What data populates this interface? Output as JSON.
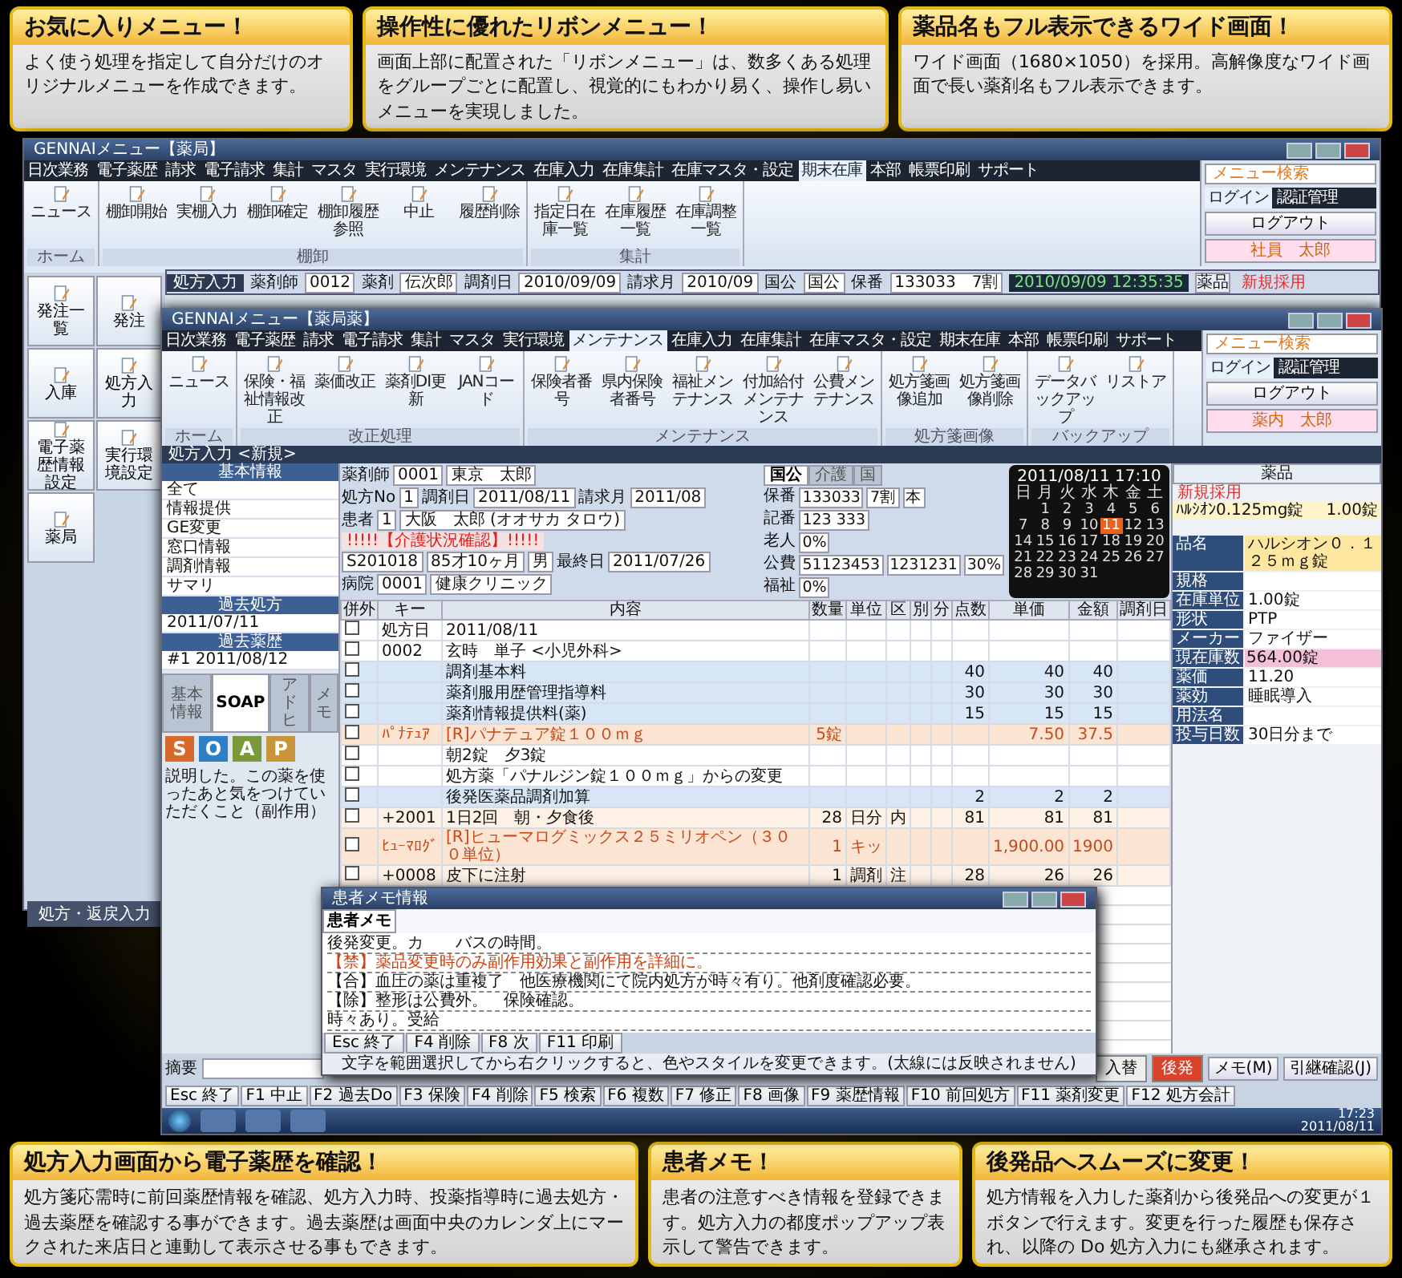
{
  "top_callouts": [
    {
      "title": "お気に入りメニュー！",
      "body": "よく使う処理を指定して自分だけのオリジナルメニューを作成できます。"
    },
    {
      "title": "操作性に優れたリボンメニュー！",
      "body": "画面上部に配置された「リボンメニュー」は、数多くある処理をグループごとに配置し、視覚的にもわかり易く、操作し易いメニューを実現しました。"
    },
    {
      "title": "薬品名もフル表示できるワイド画面！",
      "body": "ワイド画面（1680×1050）を採用。高解像度なワイド画面で長い薬剤名もフル表示できます。"
    }
  ],
  "back_window": {
    "title": "GENNAIメニュー【薬局】",
    "tabs": [
      {
        "label": "日次業務",
        "selected": false
      },
      {
        "label": "電子薬歴",
        "selected": false
      },
      {
        "label": "請求",
        "selected": false
      },
      {
        "label": "電子請求",
        "selected": false
      },
      {
        "label": "集計",
        "selected": false
      },
      {
        "label": "マスタ",
        "selected": false
      },
      {
        "label": "実行環境",
        "selected": false
      },
      {
        "label": "メンテナンス",
        "selected": false
      },
      {
        "label": "在庫入力",
        "selected": false
      },
      {
        "label": "在庫集計",
        "selected": false
      },
      {
        "label": "在庫マスタ・設定",
        "selected": false
      },
      {
        "label": "期末在庫",
        "selected": true
      },
      {
        "label": "本部",
        "selected": false
      },
      {
        "label": "帳票印刷",
        "selected": false
      },
      {
        "label": "サポート",
        "selected": false
      }
    ],
    "ribbon_groups": [
      {
        "label": "ホーム",
        "buttons": [
          "ニュース"
        ]
      },
      {
        "label": "棚卸",
        "buttons": [
          "棚卸開始",
          "実棚入力",
          "棚卸確定",
          "棚卸履歴参照",
          "中止",
          "履歴削除"
        ]
      },
      {
        "label": "集計",
        "buttons": [
          "指定日在庫一覧",
          "在庫履歴一覧",
          "在庫調整一覧"
        ]
      }
    ],
    "menu_search": {
      "placeholder": "メニュー検索"
    },
    "login_tabs": [
      {
        "label": "ログイン",
        "selected": true
      },
      {
        "label": "認証管理",
        "selected": false
      }
    ],
    "logout": "ログアウト",
    "user": "社員　太郎",
    "sidebar": [
      "発注一覧",
      "発注",
      "入庫",
      "処方入力",
      "電子薬歴情報設定",
      "実行環境設定",
      "薬局"
    ],
    "sidebar_footer": "処方・返戻入力",
    "rx": {
      "title": "処方入力",
      "fields": [
        {
          "label": "薬剤師",
          "value": "0012"
        },
        {
          "label": "薬剤",
          "value": "伝次郎"
        },
        {
          "label": "調剤日",
          "value": "2010/09/09"
        },
        {
          "label": "請求月",
          "value": "2010/09"
        }
      ],
      "insurance": [
        {
          "label": "国公",
          "value": "国公"
        },
        {
          "label": "保番",
          "value": "133033　7割"
        }
      ],
      "clock": "2010/09/09 12:35:35",
      "drug_header": "薬品",
      "drug_note": "新規採用"
    }
  },
  "front_window": {
    "title": "GENNAIメニュー【薬局薬】",
    "tabs": [
      {
        "label": "日次業務",
        "selected": false
      },
      {
        "label": "電子薬歴",
        "selected": false
      },
      {
        "label": "請求",
        "selected": false
      },
      {
        "label": "電子請求",
        "selected": false
      },
      {
        "label": "集計",
        "selected": false
      },
      {
        "label": "マスタ",
        "selected": false
      },
      {
        "label": "実行環境",
        "selected": false
      },
      {
        "label": "メンテナンス",
        "selected": true
      },
      {
        "label": "在庫入力",
        "selected": false
      },
      {
        "label": "在庫集計",
        "selected": false
      },
      {
        "label": "在庫マスタ・設定",
        "selected": false
      },
      {
        "label": "期末在庫",
        "selected": false
      },
      {
        "label": "本部",
        "selected": false
      },
      {
        "label": "帳票印刷",
        "selected": false
      },
      {
        "label": "サポート",
        "selected": false
      }
    ],
    "ribbon_groups": [
      {
        "label": "ホーム",
        "buttons": [
          "ニュース"
        ]
      },
      {
        "label": "改正処理",
        "buttons": [
          "保険・福祉情報改正",
          "薬価改正",
          "薬剤DI更新",
          "JANコード"
        ]
      },
      {
        "label": "メンテナンス",
        "buttons": [
          "保険者番号",
          "県内保険者番号",
          "福祉メンテナンス",
          "付加給付メンテナンス",
          "公費メンテナンス"
        ]
      },
      {
        "label": "処方箋画像",
        "buttons": [
          "処方箋画像追加",
          "処方箋画像削除"
        ]
      },
      {
        "label": "バックアップ",
        "buttons": [
          "データバックアップ",
          "リストア"
        ]
      }
    ],
    "menu_search": {
      "placeholder": "メニュー検索"
    },
    "login_tabs": [
      {
        "label": "ログイン",
        "selected": true
      },
      {
        "label": "認証管理",
        "selected": false
      }
    ],
    "logout": "ログアウト",
    "user": "薬内　太郎",
    "rx": {
      "title": "処方入力 <新規>",
      "left_sections": [
        {
          "header": "基本情報",
          "items": [
            "全て",
            "情報提供",
            "GE変更",
            "窓口情報",
            "調剤情報",
            "サマリ"
          ]
        },
        {
          "header": "過去処方",
          "items": [
            "2011/07/11"
          ]
        },
        {
          "header": "過去薬歴",
          "items": [
            "#1 2011/08/12"
          ]
        }
      ],
      "left_tabs": [
        {
          "label": "基本情報",
          "selected": false
        },
        {
          "label": "SOAP",
          "selected": true
        },
        {
          "label": "アドヒ",
          "selected": false
        },
        {
          "label": "メモ",
          "selected": false
        }
      ],
      "soap": [
        {
          "letter": "S",
          "color": "#d9692a"
        },
        {
          "letter": "O",
          "color": "#2f7fc8"
        },
        {
          "letter": "A",
          "color": "#7a9a3a"
        },
        {
          "letter": "P",
          "color": "#c8953a"
        }
      ],
      "soap_note": "説明した。この薬を使ったあと気をつけていただくこと（副作用）",
      "form_rows": [
        [
          {
            "label": "薬剤師",
            "value": "0001"
          },
          {
            "value": "東京　太郎"
          }
        ],
        [
          {
            "label": "処方No",
            "value": "1"
          },
          {
            "label": "調剤日",
            "value": "2011/08/11"
          },
          {
            "label": "請求月",
            "value": "2011/08"
          }
        ],
        [
          {
            "label": "患者",
            "value": "1"
          },
          {
            "value": "大阪　太郎 (オオサカ タロウ)"
          }
        ],
        [
          {
            "kind": "alert",
            "value": "!!!!!【介護状況確認】!!!!!"
          }
        ],
        [
          {
            "value": "S201018"
          },
          {
            "value": "85才10ヶ月"
          },
          {
            "value": "男"
          },
          {
            "label": "最終日",
            "value": "2011/07/26"
          }
        ],
        [
          {
            "label": "病院",
            "value": "0001"
          },
          {
            "value": "健康クリニック"
          }
        ]
      ],
      "insurance_tabs": [
        {
          "label": "国公",
          "selected": true
        },
        {
          "label": "介護",
          "selected": false
        },
        {
          "label": "国",
          "selected": false
        }
      ],
      "insurance_rows": [
        {
          "label": "保番",
          "values": [
            "133033",
            "7割",
            "本"
          ]
        },
        {
          "label": "記番",
          "values": [
            "123 333"
          ]
        },
        {
          "label": "老人",
          "values": [
            "0%"
          ]
        },
        {
          "label": "公費",
          "values": [
            "51123453",
            "1231231",
            "30%"
          ]
        },
        {
          "label": "福祉",
          "values": [
            "0%"
          ]
        }
      ],
      "calendar": {
        "title": "2011/08/11 17:10",
        "weekdays": [
          "日",
          "月",
          "火",
          "水",
          "木",
          "金",
          "土"
        ],
        "days": [
          {
            "label": "1",
            "selected": false
          },
          {
            "label": "2",
            "selected": false
          },
          {
            "label": "3",
            "selected": false
          },
          {
            "label": "4",
            "selected": false
          },
          {
            "label": "5",
            "selected": false
          },
          {
            "label": "6",
            "selected": false
          },
          {
            "label": "7",
            "selected": false
          },
          {
            "label": "8",
            "selected": false
          },
          {
            "label": "9",
            "selected": false
          },
          {
            "label": "10",
            "selected": false
          },
          {
            "label": "11",
            "selected": true
          },
          {
            "label": "12",
            "selected": false
          },
          {
            "label": "13",
            "selected": false
          },
          {
            "label": "14",
            "selected": false
          },
          {
            "label": "15",
            "selected": false
          },
          {
            "label": "16",
            "selected": false
          },
          {
            "label": "17",
            "selected": false
          },
          {
            "label": "18",
            "selected": false
          },
          {
            "label": "19",
            "selected": false
          },
          {
            "label": "20",
            "selected": false
          },
          {
            "label": "21",
            "selected": false
          },
          {
            "label": "22",
            "selected": false
          },
          {
            "label": "23",
            "selected": false
          },
          {
            "label": "24",
            "selected": false
          },
          {
            "label": "25",
            "selected": false
          },
          {
            "label": "26",
            "selected": false
          },
          {
            "label": "27",
            "selected": false
          },
          {
            "label": "28",
            "selected": false
          },
          {
            "label": "29",
            "selected": false
          },
          {
            "label": "30",
            "selected": false
          },
          {
            "label": "31",
            "selected": false
          }
        ]
      },
      "table": {
        "columns": [
          "併外",
          "キー",
          "内容",
          "数量",
          "単位",
          "区",
          "別",
          "分",
          "点数",
          "単価",
          "金額",
          "調剤日"
        ],
        "rows": [
          {
            "kind": "plain",
            "checked": false,
            "key": "処方日",
            "content": "2011/08/11"
          },
          {
            "kind": "plain",
            "checked": false,
            "key": "0002",
            "content": "玄時　単子 <小児外科>"
          },
          {
            "kind": "fee",
            "checked": false,
            "content": "調剤基本料",
            "points": "40",
            "price": "40",
            "amount": "40"
          },
          {
            "kind": "fee",
            "checked": false,
            "content": "薬剤服用歴管理指導料",
            "points": "30",
            "price": "30",
            "amount": "30"
          },
          {
            "kind": "fee",
            "checked": false,
            "content": "薬剤情報提供料(薬)",
            "points": "15",
            "price": "15",
            "amount": "15"
          },
          {
            "kind": "drug",
            "checked": false,
            "key": "ﾊﾟﾅﾃｭｱ",
            "content": "[R]パナテュア錠１００ｍｇ",
            "qty": "5錠",
            "price": "7.50",
            "amount": "37.5"
          },
          {
            "kind": "plain",
            "checked": false,
            "content": "朝2錠　夕3錠"
          },
          {
            "kind": "plain",
            "checked": false,
            "content": "処方薬「パナルジン錠１００ｍｇ」からの変更"
          },
          {
            "kind": "fee",
            "checked": false,
            "content": "後発医薬品調剤加算",
            "points": "2",
            "price": "2",
            "amount": "2"
          },
          {
            "kind": "usage",
            "checked": false,
            "key": "+2001",
            "content": "1日2回　朝・夕食後",
            "qty": "28",
            "unit": "日分",
            "div": "内",
            "points": "81",
            "price": "81",
            "amount": "81"
          },
          {
            "kind": "drug",
            "checked": false,
            "key": "ﾋｭｰﾏﾛｸﾞ",
            "content": "[R]ヒューマログミックス２５ミリオペン（３００単位）",
            "qty": "1",
            "unit": "キッ",
            "price": "1,900.00",
            "amount": "1900"
          },
          {
            "kind": "usage",
            "checked": false,
            "key": "+0008",
            "content": "皮下に注射",
            "qty": "1",
            "unit": "調剤",
            "div": "注",
            "points": "28",
            "price": "26",
            "amount": "26"
          }
        ]
      },
      "drug_panel": {
        "header": "薬品",
        "note": "新規採用",
        "item": "ﾊﾙｼｵﾝ0.125mg錠",
        "amount": "1.00錠",
        "details": [
          {
            "label": "品名",
            "value": "ハルシオン０．１２５ｍｇ錠"
          },
          {
            "label": "規格"
          },
          {
            "label": "在庫単位",
            "value": "1.00錠"
          },
          {
            "label": "形状",
            "value": "PTP"
          },
          {
            "label": "メーカー",
            "value": "ファイザー"
          },
          {
            "label": "現在庫数",
            "value": "564.00錠"
          },
          {
            "label": "薬価",
            "value": "11.20"
          },
          {
            "label": "薬効",
            "value": "睡眠導入"
          },
          {
            "label": "用法名"
          },
          {
            "label": "投与日数",
            "value": "30日分まで"
          }
        ]
      }
    },
    "memo_label": "摘要",
    "function_keys": [
      {
        "key": "Esc",
        "label": "終了"
      },
      {
        "key": "F1",
        "label": "中止"
      },
      {
        "key": "F2",
        "label": "過去Do"
      },
      {
        "key": "F3",
        "label": "保険"
      },
      {
        "key": "F4",
        "label": "削除"
      },
      {
        "key": "F5",
        "label": "検索"
      },
      {
        "key": "F6",
        "label": "複数"
      },
      {
        "key": "F7",
        "label": "修正"
      },
      {
        "key": "F8",
        "label": "画像"
      },
      {
        "key": "F9",
        "label": "薬歴情報"
      },
      {
        "key": "F10",
        "label": "前回処方"
      },
      {
        "key": "F11",
        "label": "薬剤変更"
      },
      {
        "key": "F12",
        "label": "処方会計"
      }
    ],
    "action_buttons": [
      {
        "label": "入替",
        "kind": "normal"
      },
      {
        "label": "後発",
        "kind": "accent"
      }
    ],
    "side_buttons": [
      "メモ(M)",
      "引継確認(J)"
    ],
    "memo_popup": {
      "title": "患者メモ情報",
      "tabs": [
        {
          "label": "患者メモ",
          "selected": true
        }
      ],
      "lines": [
        {
          "text": "後発変更。カ　　バスの時間。",
          "kind": "normal"
        },
        {
          "text": "【禁】薬品変更時のみ副作用効果と副作用を詳細に。",
          "kind": "warning"
        },
        {
          "text": "【合】血圧の薬は重複了　他医療機関にて院内処方が時々有り。他剤度確認必要。",
          "kind": "normal"
        },
        {
          "text": "【除】整形は公費外。　保険確認。",
          "kind": "normal"
        },
        {
          "text": "時々あり。受給",
          "kind": "normal"
        }
      ],
      "keys": [
        {
          "key": "Esc",
          "label": "終了"
        },
        {
          "key": "F4",
          "label": "削除"
        },
        {
          "key": "F8",
          "label": "次"
        },
        {
          "key": "F11",
          "label": "印刷"
        }
      ],
      "hint": "文字を範囲選択してから右クリックすると、色やスタイルを変更できます。(太線には反映されません)"
    },
    "taskbar": {
      "time": "17:23",
      "date": "2011/08/11"
    }
  },
  "bottom_callouts": [
    {
      "title": "処方入力画面から電子薬歴を確認！",
      "body": "処方箋応需時に前回薬歴情報を確認、処方入力時、投薬指導時に過去処方・過去薬歴を確認する事ができます。過去薬歴は画面中央のカレンダ上にマークされた来店日と連動して表示させる事もできます。"
    },
    {
      "title": "患者メモ！",
      "body": "患者の注意すべき情報を登録できます。処方入力の都度ポップアップ表示して警告できます。"
    },
    {
      "title": "後発品へスムーズに変更！",
      "body": "処方情報を入力した薬剤から後発品への変更が１ボタンで行えます。変更を行った履歴も保存され、以降の Do 処方入力にも継承されます。"
    }
  ]
}
